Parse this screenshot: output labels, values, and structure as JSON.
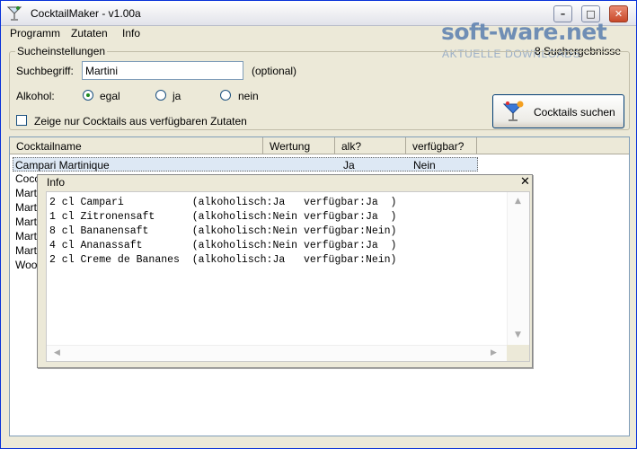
{
  "window": {
    "title": "CocktailMaker - v1.00a",
    "icon": "cocktail-glass-icon"
  },
  "title_buttons": {
    "minimize": "–",
    "maximize": "□",
    "close": "✕"
  },
  "menu": [
    "Programm",
    "Zutaten",
    "Info"
  ],
  "watermark": {
    "main": "soft-ware.net",
    "sub": "AKTUELLE DOWNLOADS"
  },
  "result_count": "8 Suchergebnisse",
  "search_settings": {
    "legend": "Sucheinstellungen",
    "term_label": "Suchbegriff:",
    "term_value": "Martini",
    "optional": "(optional)",
    "alcohol_label": "Alkohol:",
    "alcohol_options": [
      "egal",
      "ja",
      "nein"
    ],
    "alcohol_selected": "egal",
    "only_available_label": "Zeige nur Cocktails aus verfügbaren Zutaten",
    "only_available_checked": false,
    "search_button": "Cocktails suchen"
  },
  "list": {
    "columns": [
      "Cocktailname",
      "Wertung",
      "alk?",
      "verfügbar?"
    ],
    "rows": [
      {
        "name": "Campari Martinique",
        "rating": "",
        "alk": "Ja",
        "available": "Nein",
        "selected": true
      },
      {
        "name": "Coco",
        "rating": "",
        "alk": "",
        "available": ""
      },
      {
        "name": "Mart",
        "rating": "",
        "alk": "",
        "available": ""
      },
      {
        "name": "Mart",
        "rating": "",
        "alk": "",
        "available": ""
      },
      {
        "name": "Mart",
        "rating": "",
        "alk": "",
        "available": ""
      },
      {
        "name": "Mart",
        "rating": "",
        "alk": "",
        "available": ""
      },
      {
        "name": "Mart",
        "rating": "",
        "alk": "",
        "available": ""
      },
      {
        "name": "Woo",
        "rating": "",
        "alk": "",
        "available": ""
      }
    ]
  },
  "info_popup": {
    "title": "Info",
    "close": "✕",
    "lines": [
      "2 cl Campari           (alkoholisch:Ja   verfügbar:Ja  )",
      "1 cl Zitronensaft      (alkoholisch:Nein verfügbar:Ja  )",
      "8 cl Bananensaft       (alkoholisch:Nein verfügbar:Nein)",
      "4 cl Ananassaft        (alkoholisch:Nein verfügbar:Ja  )",
      "2 cl Creme de Bananes  (alkoholisch:Ja   verfügbar:Nein)"
    ],
    "scroll_arrows": {
      "up": "▲",
      "down": "▼",
      "left": "◀",
      "right": "▶"
    }
  }
}
